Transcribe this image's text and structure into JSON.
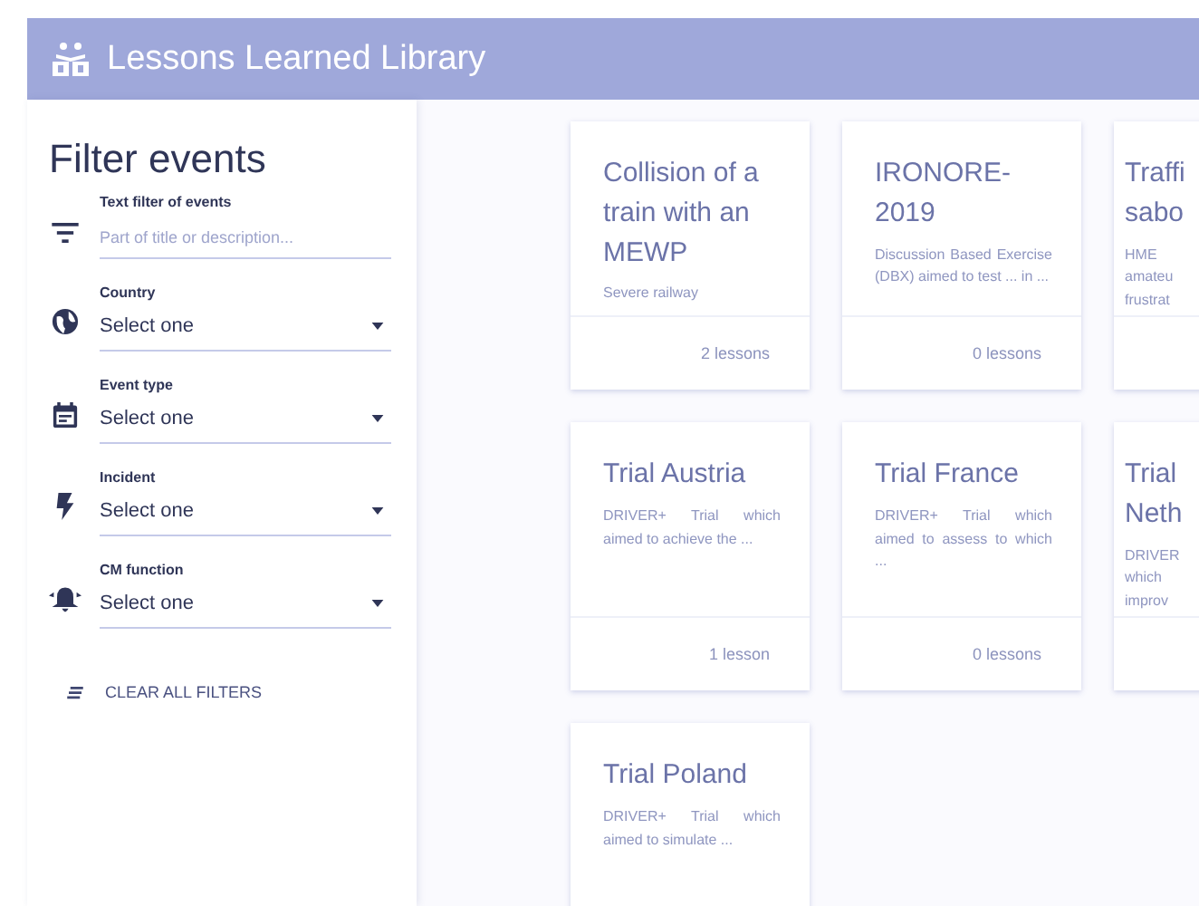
{
  "app_bar": {
    "title": "Lessons Learned Library"
  },
  "sidebar": {
    "heading": "Filter events",
    "text_filter": {
      "label": "Text filter of events",
      "placeholder": "Part of title or description..."
    },
    "selects": [
      {
        "kind": "globe",
        "label": "Country",
        "value": "Select one"
      },
      {
        "kind": "calendar",
        "label": "Event type",
        "value": "Select one"
      },
      {
        "kind": "bolt",
        "label": "Incident",
        "value": "Select one"
      },
      {
        "kind": "bell",
        "label": "CM function",
        "value": "Select one"
      }
    ],
    "clear_button": "CLEAR ALL FILTERS"
  },
  "cards": [
    {
      "title": "Collision of a train with an MEWP",
      "description": "Severe railway",
      "lessons": "2 lessons"
    },
    {
      "title": "IRONORE-2019",
      "description": "Discussion Based Exercise (DBX) aimed to test ... in ...",
      "lessons": "0 lessons"
    },
    {
      "title": "Traffi sabo",
      "description": "HME amateu frustrat"
    },
    {
      "title": "Trial Austria",
      "description": "DRIVER+ Trial which aimed to achieve the ...",
      "lessons": "1 lesson"
    },
    {
      "title": "Trial France",
      "description": "DRIVER+ Trial which aimed to assess to which ...",
      "lessons": "0 lessons"
    },
    {
      "title": "Trial Neth",
      "description": "DRIVER which improv"
    },
    {
      "title": "Trial Poland",
      "description": "DRIVER+ Trial which aimed to simulate ..."
    }
  ]
}
